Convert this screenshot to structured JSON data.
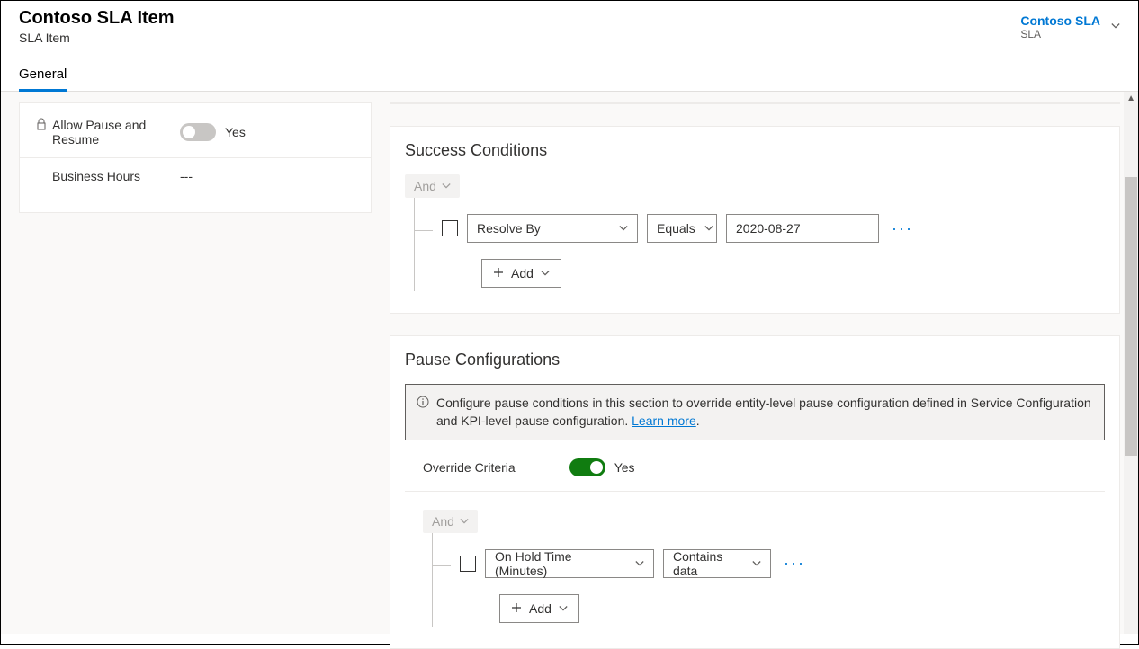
{
  "header": {
    "title": "Contoso SLA Item",
    "subtitle": "SLA Item",
    "related_link": "Contoso SLA",
    "related_sub": "SLA"
  },
  "tabs": {
    "general": "General"
  },
  "sidebar": {
    "allow_pause_label": "Allow Pause and Resume",
    "allow_pause_value": "Yes",
    "business_hours_label": "Business Hours",
    "business_hours_value": "---"
  },
  "success": {
    "title": "Success Conditions",
    "and": "And",
    "field": "Resolve By",
    "operator": "Equals",
    "value": "2020-08-27",
    "add": "Add"
  },
  "pause": {
    "title": "Pause Configurations",
    "info_text": "Configure pause conditions in this section to override entity-level pause configuration defined in Service Configuration and KPI-level pause configuration. ",
    "learn_more": "Learn more",
    "override_label": "Override Criteria",
    "override_value": "Yes",
    "and": "And",
    "field": "On Hold Time (Minutes)",
    "operator": "Contains data",
    "add": "Add"
  }
}
